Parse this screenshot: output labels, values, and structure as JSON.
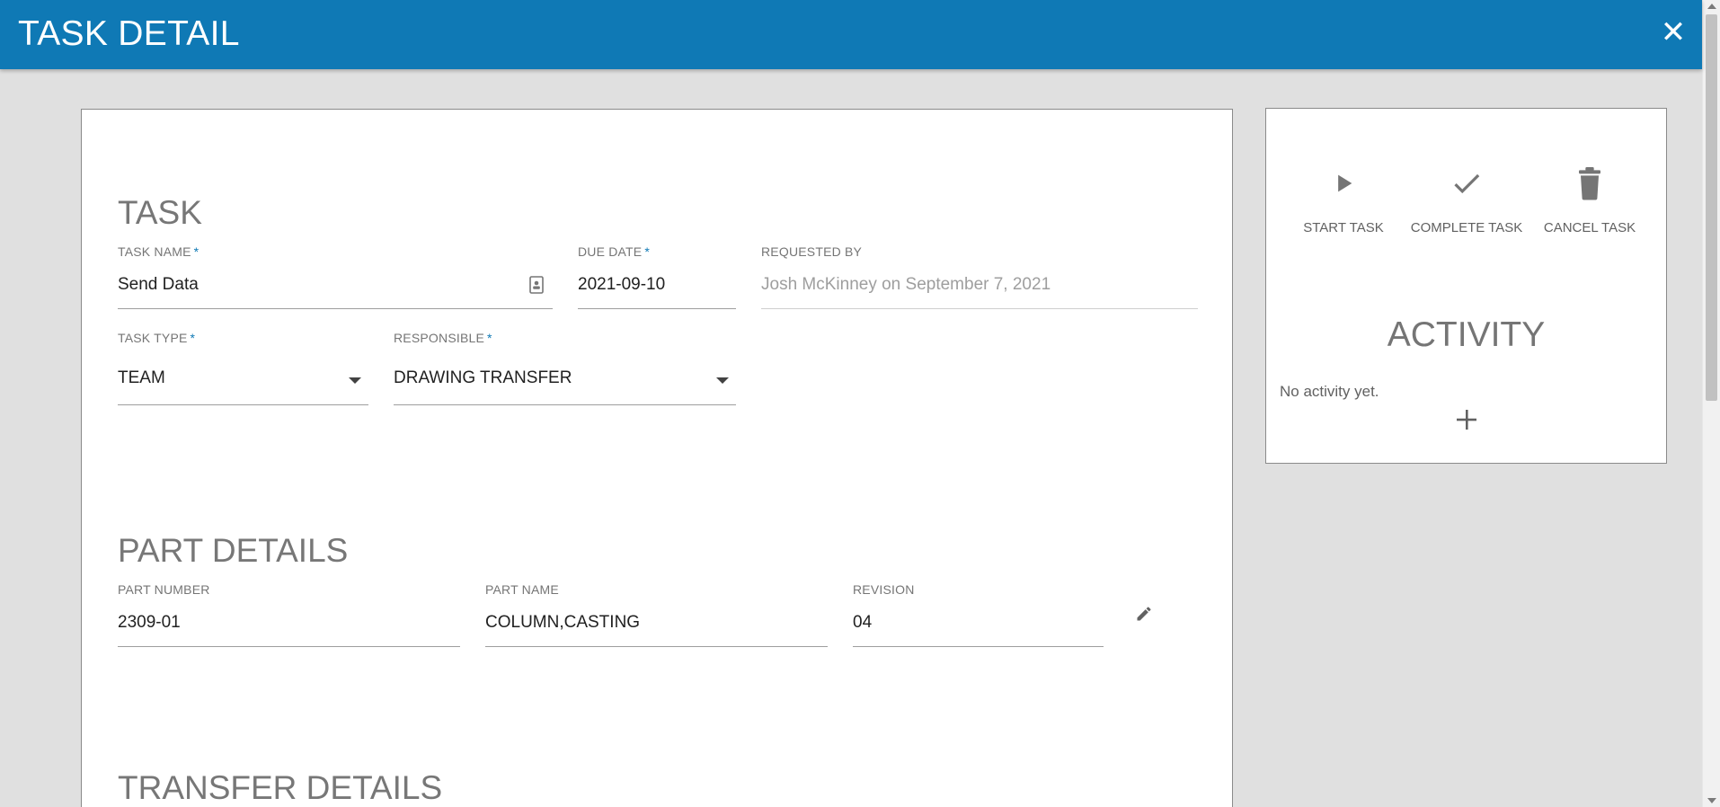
{
  "header": {
    "title": "TASK DETAIL",
    "close_glyph": "✕"
  },
  "task_section": {
    "title": "TASK",
    "task_name": {
      "label": "TASK NAME",
      "required_mark": "*",
      "value": "Send Data",
      "icon": "contact-card-icon"
    },
    "due_date": {
      "label": "DUE DATE",
      "required_mark": "*",
      "value": "2021-09-10"
    },
    "requested_by": {
      "label": "REQUESTED BY",
      "value": "Josh McKinney on September 7, 2021"
    },
    "task_type": {
      "label": "TASK TYPE",
      "required_mark": "*",
      "value": "TEAM"
    },
    "responsible": {
      "label": "RESPONSIBLE",
      "required_mark": "*",
      "value": "DRAWING TRANSFER"
    }
  },
  "part_section": {
    "title": "PART DETAILS",
    "part_number": {
      "label": "PART NUMBER",
      "value": "2309-01"
    },
    "part_name": {
      "label": "PART NAME",
      "value": "COLUMN,CASTING"
    },
    "revision": {
      "label": "REVISION",
      "value": "04"
    },
    "edit_icon": "pencil-icon"
  },
  "transfer_section": {
    "title": "TRANSFER DETAILS"
  },
  "actions": [
    {
      "label": "START TASK",
      "icon": "play-icon"
    },
    {
      "label": "COMPLETE TASK",
      "icon": "check-icon"
    },
    {
      "label": "CANCEL TASK",
      "icon": "trash-icon"
    }
  ],
  "activity": {
    "title": "ACTIVITY",
    "empty_text": "No activity yet.",
    "add_icon": "plus-icon"
  },
  "colors": {
    "header_bg": "#0f79b5",
    "required": "#0f79b5",
    "page_bg": "#e0e0e0"
  }
}
